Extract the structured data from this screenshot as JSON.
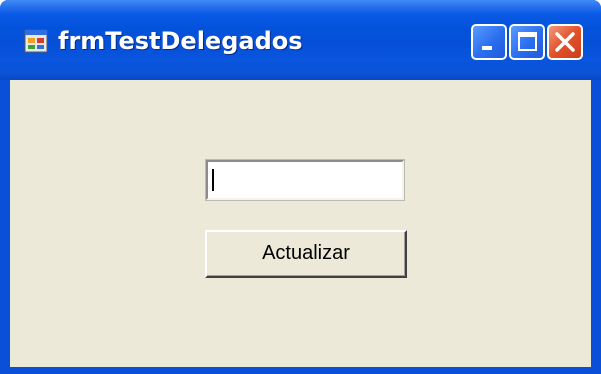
{
  "window": {
    "title": "frmTestDelegados",
    "controls": {
      "minimize": "minimize-icon",
      "maximize": "maximize-icon",
      "close": "close-icon"
    }
  },
  "form": {
    "textbox": {
      "value": "",
      "has_focus": true
    },
    "button": {
      "label": "Actualizar"
    }
  },
  "colors": {
    "titlebar": "#0452dc",
    "client_background": "#ece9d8",
    "close_button": "#e2512a"
  }
}
